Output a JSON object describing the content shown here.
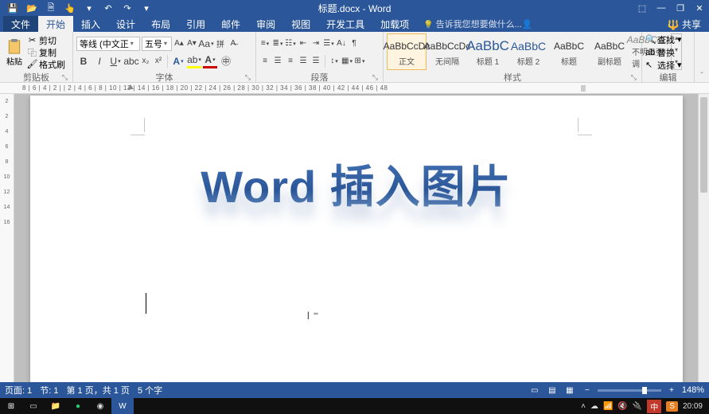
{
  "title": "标题.docx - Word",
  "tabs": {
    "file": "文件",
    "home": "开始",
    "insert": "插入",
    "design": "设计",
    "layout": "布局",
    "references": "引用",
    "mailings": "邮件",
    "review": "审阅",
    "view": "视图",
    "developer": "开发工具",
    "addins": "加载项"
  },
  "tellme": "告诉我您想要做什么...",
  "share": "共享",
  "clipboard": {
    "paste": "粘贴",
    "cut": "剪切",
    "copy": "复制",
    "formatpainter": "格式刷",
    "label": "剪贴板"
  },
  "font": {
    "name": "等线 (中文正",
    "size": "五号",
    "label": "字体"
  },
  "paragraph": {
    "label": "段落"
  },
  "styles": {
    "label": "样式",
    "preview": "AaBbC",
    "previewCc": "AaBbCcDc",
    "items": [
      {
        "name": "正文"
      },
      {
        "name": "无间隔"
      },
      {
        "name": "标题 1"
      },
      {
        "name": "标题 2"
      },
      {
        "name": "标题"
      },
      {
        "name": "副标题"
      },
      {
        "name": "不明显强调"
      }
    ]
  },
  "editing": {
    "find": "查找",
    "replace": "替换",
    "select": "选择",
    "label": "编辑"
  },
  "ruler_h": "8 | 6 | 4 | 2 |  | 2 | 4 | 6 | 8 | 10 | 12 | 14 | 16 | 18 | 20 | 22 | 24 | 26 | 28 | 30 | 32 | 34 | 36 | 38 | 40 | 42 | 44 | 46 | 48",
  "ruler_v": [
    "2",
    "",
    "2",
    "4",
    "6",
    "8",
    "10",
    "12",
    "14",
    "16"
  ],
  "document": {
    "wordart": "Word 插入图片"
  },
  "statusbar": {
    "page": "页面: 1",
    "section": "节: 1",
    "pageof": "第 1 页，共 1 页",
    "words": "5 个字",
    "zoom": "148%"
  },
  "taskbar": {
    "ime": "中",
    "time": "20:09"
  }
}
